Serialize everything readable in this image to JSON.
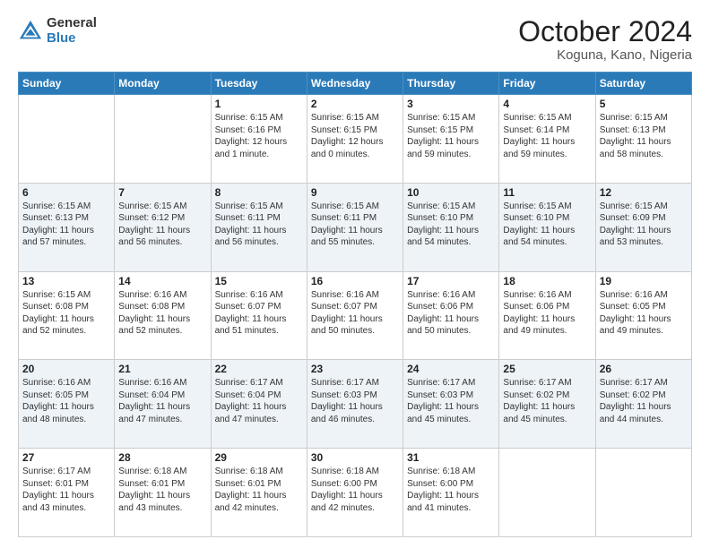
{
  "header": {
    "logo_general": "General",
    "logo_blue": "Blue",
    "month": "October 2024",
    "location": "Koguna, Kano, Nigeria"
  },
  "weekdays": [
    "Sunday",
    "Monday",
    "Tuesday",
    "Wednesday",
    "Thursday",
    "Friday",
    "Saturday"
  ],
  "weeks": [
    [
      {
        "day": "",
        "text": ""
      },
      {
        "day": "",
        "text": ""
      },
      {
        "day": "1",
        "text": "Sunrise: 6:15 AM\nSunset: 6:16 PM\nDaylight: 12 hours\nand 1 minute."
      },
      {
        "day": "2",
        "text": "Sunrise: 6:15 AM\nSunset: 6:15 PM\nDaylight: 12 hours\nand 0 minutes."
      },
      {
        "day": "3",
        "text": "Sunrise: 6:15 AM\nSunset: 6:15 PM\nDaylight: 11 hours\nand 59 minutes."
      },
      {
        "day": "4",
        "text": "Sunrise: 6:15 AM\nSunset: 6:14 PM\nDaylight: 11 hours\nand 59 minutes."
      },
      {
        "day": "5",
        "text": "Sunrise: 6:15 AM\nSunset: 6:13 PM\nDaylight: 11 hours\nand 58 minutes."
      }
    ],
    [
      {
        "day": "6",
        "text": "Sunrise: 6:15 AM\nSunset: 6:13 PM\nDaylight: 11 hours\nand 57 minutes."
      },
      {
        "day": "7",
        "text": "Sunrise: 6:15 AM\nSunset: 6:12 PM\nDaylight: 11 hours\nand 56 minutes."
      },
      {
        "day": "8",
        "text": "Sunrise: 6:15 AM\nSunset: 6:11 PM\nDaylight: 11 hours\nand 56 minutes."
      },
      {
        "day": "9",
        "text": "Sunrise: 6:15 AM\nSunset: 6:11 PM\nDaylight: 11 hours\nand 55 minutes."
      },
      {
        "day": "10",
        "text": "Sunrise: 6:15 AM\nSunset: 6:10 PM\nDaylight: 11 hours\nand 54 minutes."
      },
      {
        "day": "11",
        "text": "Sunrise: 6:15 AM\nSunset: 6:10 PM\nDaylight: 11 hours\nand 54 minutes."
      },
      {
        "day": "12",
        "text": "Sunrise: 6:15 AM\nSunset: 6:09 PM\nDaylight: 11 hours\nand 53 minutes."
      }
    ],
    [
      {
        "day": "13",
        "text": "Sunrise: 6:15 AM\nSunset: 6:08 PM\nDaylight: 11 hours\nand 52 minutes."
      },
      {
        "day": "14",
        "text": "Sunrise: 6:16 AM\nSunset: 6:08 PM\nDaylight: 11 hours\nand 52 minutes."
      },
      {
        "day": "15",
        "text": "Sunrise: 6:16 AM\nSunset: 6:07 PM\nDaylight: 11 hours\nand 51 minutes."
      },
      {
        "day": "16",
        "text": "Sunrise: 6:16 AM\nSunset: 6:07 PM\nDaylight: 11 hours\nand 50 minutes."
      },
      {
        "day": "17",
        "text": "Sunrise: 6:16 AM\nSunset: 6:06 PM\nDaylight: 11 hours\nand 50 minutes."
      },
      {
        "day": "18",
        "text": "Sunrise: 6:16 AM\nSunset: 6:06 PM\nDaylight: 11 hours\nand 49 minutes."
      },
      {
        "day": "19",
        "text": "Sunrise: 6:16 AM\nSunset: 6:05 PM\nDaylight: 11 hours\nand 49 minutes."
      }
    ],
    [
      {
        "day": "20",
        "text": "Sunrise: 6:16 AM\nSunset: 6:05 PM\nDaylight: 11 hours\nand 48 minutes."
      },
      {
        "day": "21",
        "text": "Sunrise: 6:16 AM\nSunset: 6:04 PM\nDaylight: 11 hours\nand 47 minutes."
      },
      {
        "day": "22",
        "text": "Sunrise: 6:17 AM\nSunset: 6:04 PM\nDaylight: 11 hours\nand 47 minutes."
      },
      {
        "day": "23",
        "text": "Sunrise: 6:17 AM\nSunset: 6:03 PM\nDaylight: 11 hours\nand 46 minutes."
      },
      {
        "day": "24",
        "text": "Sunrise: 6:17 AM\nSunset: 6:03 PM\nDaylight: 11 hours\nand 45 minutes."
      },
      {
        "day": "25",
        "text": "Sunrise: 6:17 AM\nSunset: 6:02 PM\nDaylight: 11 hours\nand 45 minutes."
      },
      {
        "day": "26",
        "text": "Sunrise: 6:17 AM\nSunset: 6:02 PM\nDaylight: 11 hours\nand 44 minutes."
      }
    ],
    [
      {
        "day": "27",
        "text": "Sunrise: 6:17 AM\nSunset: 6:01 PM\nDaylight: 11 hours\nand 43 minutes."
      },
      {
        "day": "28",
        "text": "Sunrise: 6:18 AM\nSunset: 6:01 PM\nDaylight: 11 hours\nand 43 minutes."
      },
      {
        "day": "29",
        "text": "Sunrise: 6:18 AM\nSunset: 6:01 PM\nDaylight: 11 hours\nand 42 minutes."
      },
      {
        "day": "30",
        "text": "Sunrise: 6:18 AM\nSunset: 6:00 PM\nDaylight: 11 hours\nand 42 minutes."
      },
      {
        "day": "31",
        "text": "Sunrise: 6:18 AM\nSunset: 6:00 PM\nDaylight: 11 hours\nand 41 minutes."
      },
      {
        "day": "",
        "text": ""
      },
      {
        "day": "",
        "text": ""
      }
    ]
  ]
}
